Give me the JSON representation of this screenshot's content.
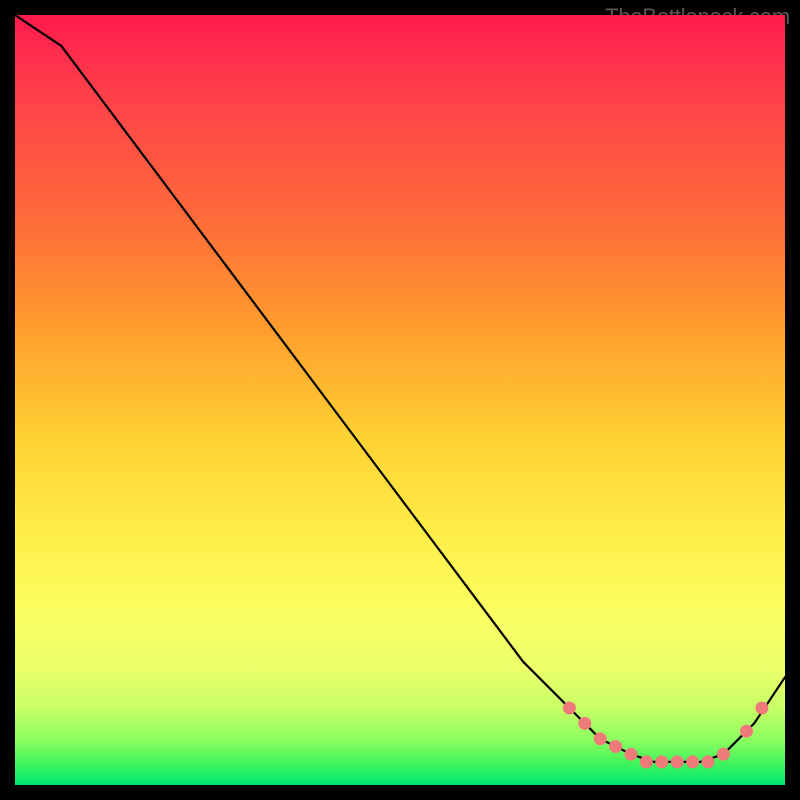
{
  "watermark": "TheBottleneck.com",
  "colors": {
    "curve_stroke": "#000000",
    "marker_fill": "#ef7a7a",
    "marker_stroke": "#ef7a7a"
  },
  "chart_data": {
    "type": "line",
    "title": "",
    "xlabel": "",
    "ylabel": "",
    "xlim": [
      0,
      100
    ],
    "ylim": [
      0,
      100
    ],
    "grid": false,
    "legend": false,
    "x": [
      0,
      6,
      12,
      18,
      24,
      30,
      36,
      42,
      48,
      54,
      60,
      66,
      72,
      76,
      80,
      83,
      86,
      89,
      92,
      96,
      100
    ],
    "values": [
      100,
      96,
      88,
      80,
      72,
      64,
      56,
      48,
      40,
      32,
      24,
      16,
      10,
      6,
      4,
      3,
      3,
      3,
      4,
      8,
      14
    ],
    "markers": {
      "x": [
        72,
        74,
        76,
        78,
        80,
        82,
        84,
        86,
        88,
        90,
        92,
        95,
        97
      ],
      "values": [
        10,
        8,
        6,
        5,
        4,
        3,
        3,
        3,
        3,
        3,
        4,
        7,
        10
      ]
    }
  }
}
